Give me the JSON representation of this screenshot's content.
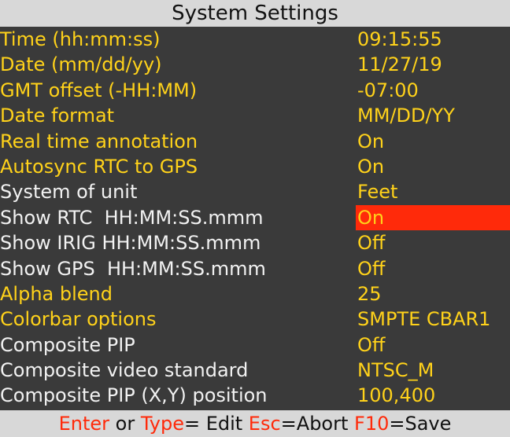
{
  "title": "System Settings",
  "colors": {
    "yellow": "#ffd21a",
    "white": "#f2f2f2",
    "highlight": "#ff2a0a",
    "background": "#3a3a3a",
    "bar": "#d8d8d8"
  },
  "rows": [
    {
      "label": "Time (hh:mm:ss)",
      "value": "09:15:55",
      "label_color": "yellow"
    },
    {
      "label": "Date (mm/dd/yy)",
      "value": "11/27/19",
      "label_color": "yellow"
    },
    {
      "label": "GMT offset (-HH:MM)",
      "value": "-07:00",
      "label_color": "yellow"
    },
    {
      "label": "Date format",
      "value": "MM/DD/YY",
      "label_color": "yellow"
    },
    {
      "label": "Real time annotation",
      "value": "On",
      "label_color": "yellow"
    },
    {
      "label": "Autosync RTC to GPS",
      "value": "On",
      "label_color": "yellow"
    },
    {
      "label": "System of unit",
      "value": "Feet",
      "label_color": "white"
    },
    {
      "label": "Show RTC  HH:MM:SS.mmm",
      "value": "On",
      "label_color": "white",
      "selected": true
    },
    {
      "label": "Show IRIG HH:MM:SS.mmm",
      "value": "Off",
      "label_color": "white"
    },
    {
      "label": "Show GPS  HH:MM:SS.mmm",
      "value": "Off",
      "label_color": "white"
    },
    {
      "label": "Alpha blend",
      "value": "25",
      "label_color": "yellow"
    },
    {
      "label": "Colorbar options",
      "value": "SMPTE CBAR1",
      "label_color": "yellow"
    },
    {
      "label": "Composite PIP",
      "value": "Off",
      "label_color": "white"
    },
    {
      "label": "Composite video standard",
      "value": "NTSC_M",
      "label_color": "white"
    },
    {
      "label": "Composite PIP (X,Y) position",
      "value": "100,400",
      "label_color": "white"
    }
  ],
  "footer": {
    "enter_key": "Enter",
    "or_text": " or ",
    "type_key": "Type",
    "edit_text": "= Edit ",
    "esc_key": "Esc",
    "abort_text": "=Abort ",
    "f10_key": "F10",
    "save_text": "=Save"
  }
}
